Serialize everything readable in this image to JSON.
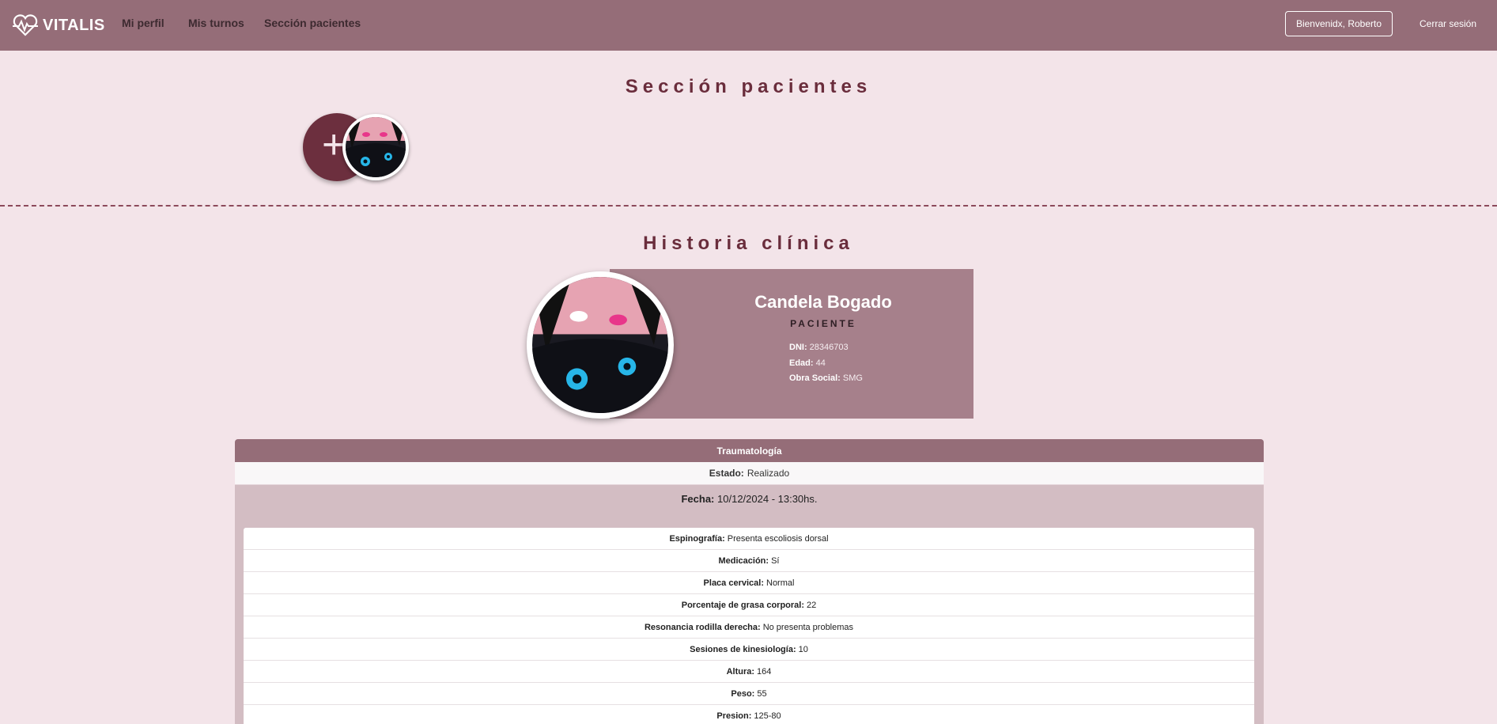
{
  "nav": {
    "brand": "VITALIS",
    "links": [
      "Mi perfil",
      "Mis turnos",
      "Sección pacientes"
    ],
    "welcome": "Bienvenidx, Roberto",
    "logout": "Cerrar sesión"
  },
  "patients_section": {
    "title": "Sección pacientes",
    "add_symbol": "+"
  },
  "history": {
    "title": "Historia clínica",
    "patient": {
      "name": "Candela Bogado",
      "role": "PACIENTE",
      "dni_label": "DNI:",
      "dni": "28346703",
      "age_label": "Edad:",
      "age": "44",
      "insurance_label": "Obra Social:",
      "insurance": "SMG"
    },
    "record": {
      "specialty": "Traumatología",
      "status_label": "Estado:",
      "status": "Realizado",
      "date_label": "Fecha:",
      "date": "10/12/2024 - 13:30hs.",
      "items": [
        {
          "label": "Espinografía:",
          "value": "Presenta escoliosis dorsal"
        },
        {
          "label": "Medicación:",
          "value": "Sí"
        },
        {
          "label": "Placa cervical:",
          "value": "Normal"
        },
        {
          "label": "Porcentaje de grasa corporal:",
          "value": "22"
        },
        {
          "label": "Resonancia rodilla derecha:",
          "value": "No presenta problemas"
        },
        {
          "label": "Sesiones de kinesiología:",
          "value": "10"
        },
        {
          "label": "Altura:",
          "value": "164"
        },
        {
          "label": "Peso:",
          "value": "55"
        },
        {
          "label": "Presion:",
          "value": "125-80"
        }
      ]
    }
  },
  "colors": {
    "navbar": "#956d78",
    "background": "#f3e4e9",
    "accent": "#6c2f3e",
    "card": "#a6808b"
  }
}
